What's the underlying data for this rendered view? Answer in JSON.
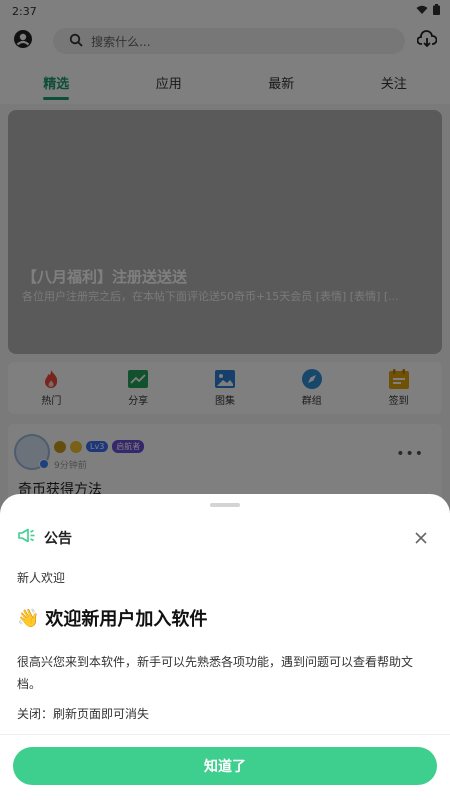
{
  "status_bar": {
    "time": "2:37"
  },
  "search": {
    "placeholder": "搜索什么..."
  },
  "tabs": [
    {
      "label": "精选",
      "active": true
    },
    {
      "label": "应用",
      "active": false
    },
    {
      "label": "最新",
      "active": false
    },
    {
      "label": "关注",
      "active": false
    }
  ],
  "banner": {
    "title": "【八月福利】注册送送送",
    "subtitle": "各位用户注册完之后，在本帖下面评论送50奇币+15天会员 [表情] [表情] [..."
  },
  "quick_nav": [
    {
      "label": "热门",
      "icon": "fire-icon",
      "color": "#ef4a3c"
    },
    {
      "label": "分享",
      "icon": "chart-icon",
      "color": "#23a35a"
    },
    {
      "label": "图集",
      "icon": "image-icon",
      "color": "#2f7fd6"
    },
    {
      "label": "群组",
      "icon": "compass-icon",
      "color": "#2f8fd6"
    },
    {
      "label": "签到",
      "icon": "calendar-icon",
      "color": "#e3a20c"
    }
  ],
  "post": {
    "level_badge": "Lv3",
    "role_badge": "启航者",
    "time": "9分钟前",
    "title": "奇币获得方法",
    "more_label": "•••"
  },
  "sheet": {
    "title": "公告",
    "subtitle": "新人欢迎",
    "heading_emoji": "👋",
    "heading": "欢迎新用户加入软件",
    "body": "很高兴您来到本软件，新手可以先熟悉各项功能，遇到问题可以查看帮助文档。",
    "close_hint": "关闭：刷新页面即可消失",
    "confirm_label": "知道了"
  },
  "colors": {
    "accent": "#1a9c6f",
    "confirm_button": "#3ecf8e",
    "level_badge": "#3b6ff5",
    "role_badge": "#6a4fd8"
  }
}
